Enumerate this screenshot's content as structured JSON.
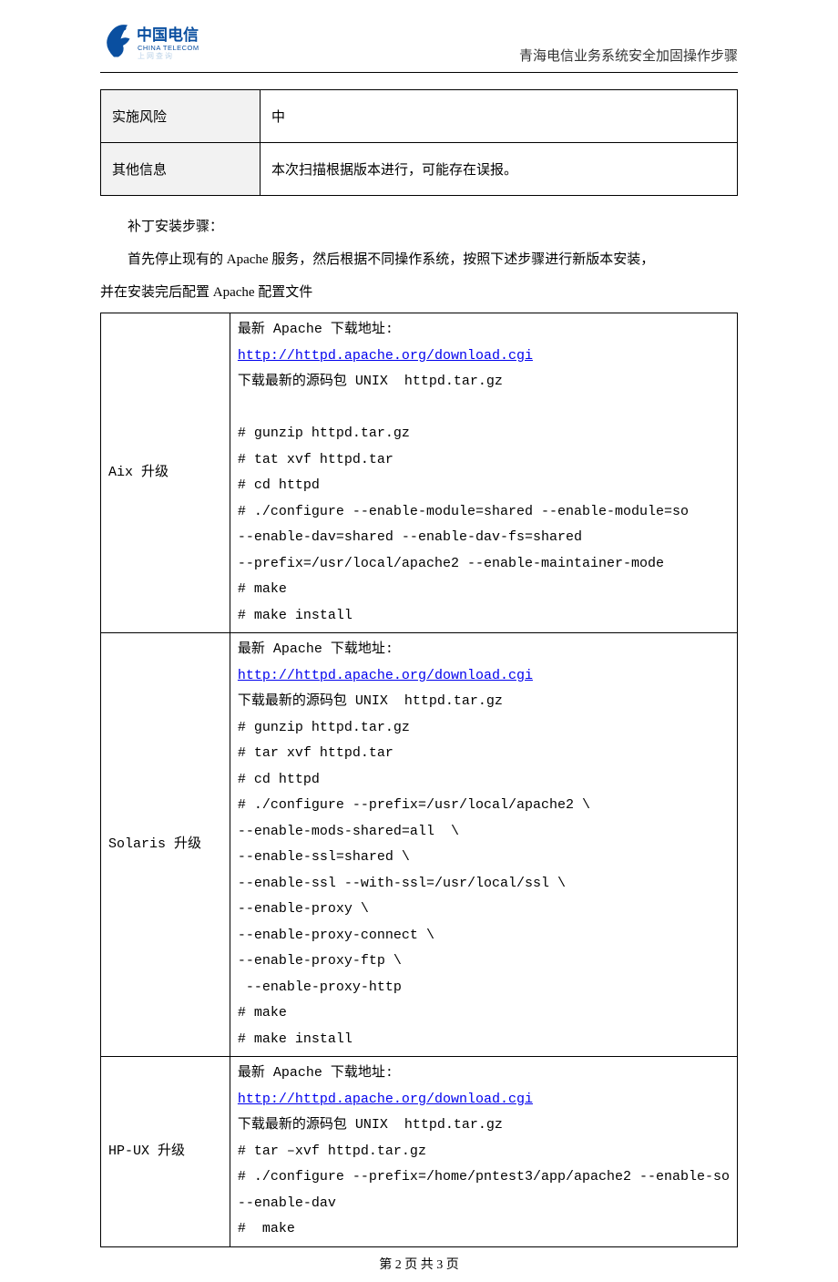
{
  "header": {
    "logo_alt": "中国电信 CHINA TELECOM",
    "title": "青海电信业务系统安全加固操作步骤"
  },
  "meta": {
    "rows": [
      {
        "label": "实施风险",
        "value": "中"
      },
      {
        "label": "其他信息",
        "value": "本次扫描根据版本进行，可能存在误报。"
      }
    ]
  },
  "body": {
    "p1": "补丁安装步骤：",
    "p2": "首先停止现有的 Apache 服务，然后根据不同操作系统，按照下述步骤进行新版本安装，",
    "p3_noindent": "并在安装完后配置 Apache 配置文件"
  },
  "upgrade": {
    "link_text": "http://httpd.apache.org/download.cgi",
    "rows": [
      {
        "os": "Aix 升级",
        "pre": "最新 Apache 下载地址:",
        "post": "下载最新的源码包 UNIX  httpd.tar.gz\n\n# gunzip httpd.tar.gz\n# tat xvf httpd.tar\n# cd httpd\n# ./configure --enable-module=shared --enable-module=so\n--enable-dav=shared --enable-dav-fs=shared\n--prefix=/usr/local/apache2 --enable-maintainer-mode\n# make\n# make install"
      },
      {
        "os": "Solaris 升级",
        "pre": "最新 Apache 下载地址:",
        "post": "下载最新的源码包 UNIX  httpd.tar.gz\n# gunzip httpd.tar.gz\n# tar xvf httpd.tar\n# cd httpd\n# ./configure --prefix=/usr/local/apache2 \\\n--enable-mods-shared=all  \\\n--enable-ssl=shared \\\n--enable-ssl --with-ssl=/usr/local/ssl \\\n--enable-proxy \\\n--enable-proxy-connect \\\n--enable-proxy-ftp \\\n --enable-proxy-http\n# make\n# make install"
      },
      {
        "os": "HP-UX 升级",
        "pre": "最新 Apache 下载地址:",
        "post": "下载最新的源码包 UNIX  httpd.tar.gz\n# tar –xvf httpd.tar.gz\n# ./configure --prefix=/home/pntest3/app/apache2 --enable-so\n--enable-dav\n#  make"
      }
    ]
  },
  "footer": "第 2 页 共 3 页"
}
